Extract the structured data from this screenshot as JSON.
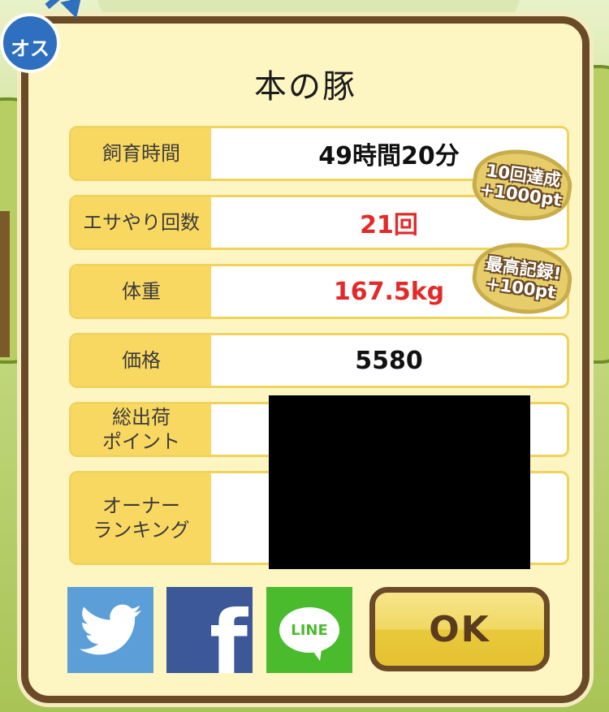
{
  "title": "本の豚",
  "rows": [
    {
      "label": "飼育時間",
      "value": "49時間20分",
      "highlight": false
    },
    {
      "label": "エサやり回数",
      "value": "21回",
      "highlight": true
    },
    {
      "label": "体重",
      "value": "167.5kg",
      "highlight": true
    },
    {
      "label": "価格",
      "value": "5580",
      "highlight": false
    },
    {
      "label": "総出荷\nポイント",
      "value": "",
      "highlight": false
    },
    {
      "label": "オーナー\nランキング",
      "value": "",
      "highlight": false
    }
  ],
  "badges": [
    {
      "line1": "10回達成",
      "line2": "+1000pt"
    },
    {
      "line1": "最高記録!",
      "line2": "+100pt"
    }
  ],
  "gender_badge": "オス",
  "share": {
    "twitter_icon": "twitter-bird-icon",
    "facebook_text": "f",
    "line_text": "LINE"
  },
  "ok_button": "OK",
  "colors": {
    "brown": "#6b4a27",
    "panel": "#fdf6c3",
    "label_bg": "#f9d862",
    "value_red": "#e12b2b"
  }
}
